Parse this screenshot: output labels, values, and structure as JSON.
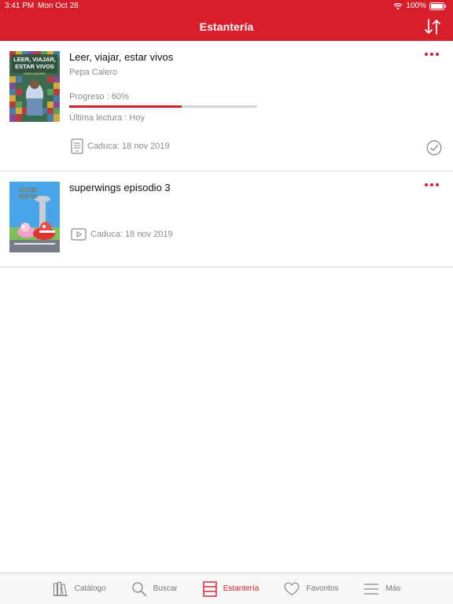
{
  "status_bar": {
    "time": "3:41 PM",
    "date": "Mon Oct 28",
    "battery": "100%"
  },
  "header": {
    "title": "Estantería",
    "sort_icon": "sort-arrows-icon"
  },
  "colors": {
    "brand": "#d81e2b",
    "muted_text": "#8a8a8a",
    "tab_inactive": "#777777"
  },
  "shelf": {
    "items": [
      {
        "title": "Leer, viajar, estar vivos",
        "author": "Pepa Calero",
        "progress_label": "Progreso : 60%",
        "progress": 0.6,
        "last_read": "Última lectura : Hoy",
        "expiry": "Caduca: 18 nov 2019",
        "type_icon": "ebook-icon",
        "cover_text": [
          "LEER, VIAJAR,",
          "ESTAR VIVOS",
          "PEPA CALERO"
        ],
        "completed_icon": "check-circle-icon"
      },
      {
        "title": "superwings episodio 3",
        "expiry": "Caduca: 18 nov 2019",
        "type_icon": "video-icon",
        "cover_text": [
          "SUPER",
          "WINGS"
        ]
      }
    ]
  },
  "tab_bar": {
    "tabs": [
      {
        "label": "Catálogo",
        "icon": "books-icon"
      },
      {
        "label": "Buscar",
        "icon": "search-icon"
      },
      {
        "label": "Estantería",
        "icon": "shelf-icon",
        "active": true
      },
      {
        "label": "Favoritos",
        "icon": "heart-icon"
      },
      {
        "label": "Más",
        "icon": "menu-icon"
      }
    ]
  }
}
